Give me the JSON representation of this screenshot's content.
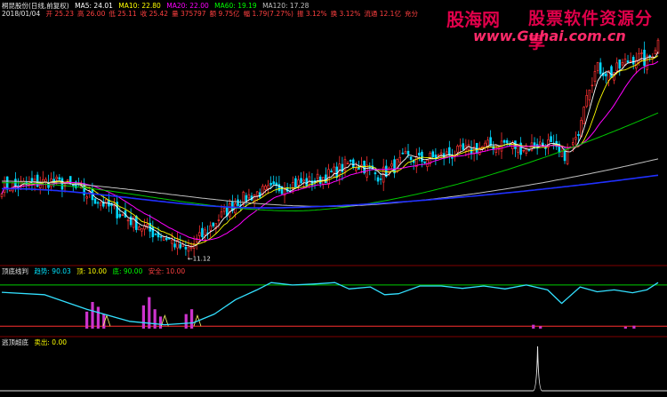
{
  "header": {
    "line1": {
      "stock": "桐昆股份(日线,前复权)",
      "ma5": "MA5: 24.01",
      "ma10": "MA10: 22.80",
      "ma20": "MA20: 22.00",
      "ma60": "MA60: 19.19",
      "ma120": "MA120: 17.28"
    },
    "line2": {
      "date": "2018/01/04",
      "items": [
        "开 25.23",
        "高 26.00",
        "低 25.11",
        "收 25.42",
        "量 375797",
        "额 9.75亿",
        "幅 1.79(7.27%)",
        "振 3.12%",
        "换 3.12%",
        "流通 12.1亿",
        "充分"
      ]
    },
    "colors": {
      "stock": "#e6e6e6",
      "ma5": "#ffffff",
      "ma10": "#ffff00",
      "ma20": "#ff00ff",
      "ma60": "#00ff00",
      "ma120": "#c0c0c0",
      "date": "#e6e6e6",
      "items": "#ff4040"
    }
  },
  "watermark": {
    "brand": "股海网",
    "slogan": "股票软件资源分享",
    "url": "www.Guhai.com.cn"
  },
  "sub1": {
    "title": "顶底线判",
    "l1": "趋势: 90.03",
    "l2": "顶: 10.00",
    "l3": "底: 90.00",
    "l4": "安全: 10.00",
    "colors": {
      "title": "#e6e6e6",
      "l1": "#00e5ff",
      "l2": "#ffff00",
      "l3": "#00ff00",
      "l4": "#ff4040"
    }
  },
  "sub2": {
    "title": "逃顶超底",
    "l1": "卖出: 0.00",
    "colors": {
      "title": "#e6e6e6",
      "l1": "#ffff00"
    }
  },
  "chart_data": [
    {
      "type": "candlestick",
      "title": "桐昆股份(日线,前复权)",
      "annotations": [
        {
          "text": "11.12",
          "price": 11.12
        }
      ],
      "ylim": [
        10.5,
        27
      ],
      "n_candles": 240,
      "price_path": [
        [
          0,
          15.6
        ],
        [
          20,
          15.8
        ],
        [
          35,
          16.0
        ],
        [
          50,
          15.6
        ],
        [
          70,
          14.6
        ],
        [
          90,
          13.4
        ],
        [
          105,
          12.6
        ],
        [
          115,
          12.3
        ],
        [
          125,
          11.6
        ],
        [
          130,
          11.3
        ],
        [
          138,
          12.0
        ],
        [
          150,
          13.2
        ],
        [
          165,
          14.6
        ],
        [
          180,
          15.2
        ],
        [
          190,
          15.4
        ],
        [
          205,
          15.8
        ],
        [
          220,
          16.0
        ],
        [
          235,
          16.6
        ],
        [
          245,
          17.2
        ],
        [
          255,
          17.0
        ],
        [
          265,
          16.4
        ],
        [
          275,
          16.8
        ],
        [
          285,
          17.6
        ],
        [
          295,
          17.4
        ],
        [
          305,
          17.6
        ],
        [
          315,
          17.8
        ],
        [
          325,
          18.0
        ],
        [
          335,
          18.2
        ],
        [
          345,
          18.4
        ],
        [
          355,
          18.6
        ],
        [
          365,
          18.2
        ],
        [
          375,
          18.4
        ],
        [
          385,
          18.6
        ],
        [
          395,
          17.6
        ],
        [
          405,
          18.6
        ],
        [
          412,
          22.0
        ],
        [
          420,
          23.6
        ],
        [
          430,
          23.2
        ],
        [
          440,
          24.0
        ],
        [
          448,
          24.4
        ],
        [
          455,
          24.0
        ],
        [
          463,
          25.4
        ]
      ],
      "ma_levels": {
        "ma60_start": 15.9,
        "ma60_low": 14.0,
        "ma60_end": 20.6,
        "ma120_start": 16.0,
        "ma120_low": 14.3,
        "ma120_end": 17.5,
        "ma_long_end": 16.4
      },
      "series": [
        {
          "name": "MA5",
          "value": 24.01,
          "color": "#ffffff"
        },
        {
          "name": "MA10",
          "value": 22.8,
          "color": "#ffff00"
        },
        {
          "name": "MA20",
          "value": 22.0,
          "color": "#ff00ff"
        },
        {
          "name": "MA60",
          "value": 19.19,
          "color": "#00ff00"
        },
        {
          "name": "MA120",
          "value": 17.28,
          "color": "#c0c0c0"
        }
      ]
    },
    {
      "type": "line",
      "title": "顶底线判",
      "ylim": [
        0,
        110
      ],
      "reference_lines": [
        {
          "value": 90,
          "color": "#00cc00"
        },
        {
          "value": 5,
          "color": "#ff3030"
        }
      ],
      "trend": [
        [
          0,
          75
        ],
        [
          30,
          70
        ],
        [
          60,
          40
        ],
        [
          90,
          15
        ],
        [
          115,
          8
        ],
        [
          135,
          12
        ],
        [
          150,
          30
        ],
        [
          165,
          60
        ],
        [
          180,
          80
        ],
        [
          190,
          95
        ],
        [
          205,
          90
        ],
        [
          220,
          92
        ],
        [
          235,
          95
        ],
        [
          245,
          82
        ],
        [
          260,
          86
        ],
        [
          270,
          70
        ],
        [
          280,
          72
        ],
        [
          295,
          88
        ],
        [
          310,
          88
        ],
        [
          325,
          83
        ],
        [
          340,
          88
        ],
        [
          355,
          82
        ],
        [
          370,
          90
        ],
        [
          385,
          80
        ],
        [
          395,
          52
        ],
        [
          408,
          86
        ],
        [
          420,
          76
        ],
        [
          432,
          80
        ],
        [
          445,
          74
        ],
        [
          455,
          80
        ],
        [
          463,
          95
        ]
      ],
      "bars": [
        {
          "x": 60,
          "v": 35
        },
        {
          "x": 64,
          "v": 55
        },
        {
          "x": 68,
          "v": 45
        },
        {
          "x": 72,
          "v": 30
        },
        {
          "x": 100,
          "v": 48
        },
        {
          "x": 104,
          "v": 65
        },
        {
          "x": 108,
          "v": 40
        },
        {
          "x": 112,
          "v": 25
        },
        {
          "x": 130,
          "v": 30
        },
        {
          "x": 134,
          "v": 40
        },
        {
          "x": 375,
          "v": 8
        },
        {
          "x": 380,
          "v": 5
        },
        {
          "x": 440,
          "v": 4
        },
        {
          "x": 446,
          "v": 6
        }
      ],
      "signals": [
        {
          "x": 74,
          "type": "buy"
        },
        {
          "x": 115,
          "type": "buy"
        },
        {
          "x": 138,
          "type": "buy"
        }
      ]
    },
    {
      "type": "line",
      "title": "逃顶超底",
      "ylim": [
        0,
        100
      ],
      "spikes": [
        {
          "x": 378,
          "value": 100
        }
      ]
    }
  ]
}
